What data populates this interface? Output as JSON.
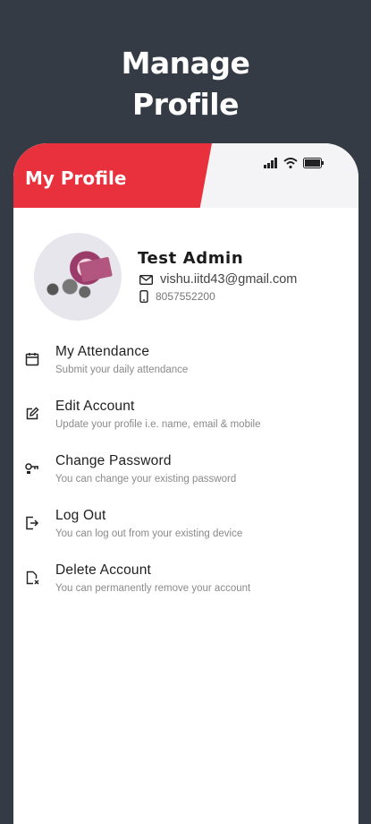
{
  "promo": {
    "line1": "Manage",
    "line2": "Profile"
  },
  "appbar": {
    "title": "My Profile",
    "accent_color": "#e8313c"
  },
  "status_bar": {
    "icons": [
      "signal-icon",
      "wifi-icon",
      "battery-icon"
    ]
  },
  "profile": {
    "name": "Test Admin",
    "email": "vishu.iitd43@gmail.com",
    "phone": "8057552200"
  },
  "menu": {
    "items": [
      {
        "title": "My Attendance",
        "subtitle": "Submit your daily attendance",
        "icon": "calendar-icon"
      },
      {
        "title": "Edit Account",
        "subtitle": "Update your profile i.e. name, email & mobile",
        "icon": "edit-icon"
      },
      {
        "title": "Change Password",
        "subtitle": "You can change your existing password",
        "icon": "key-icon"
      },
      {
        "title": "Log Out",
        "subtitle": "You can log out from your existing device",
        "icon": "logout-icon"
      },
      {
        "title": "Delete Account",
        "subtitle": "You can permanently remove your account",
        "icon": "delete-account-icon"
      }
    ]
  }
}
